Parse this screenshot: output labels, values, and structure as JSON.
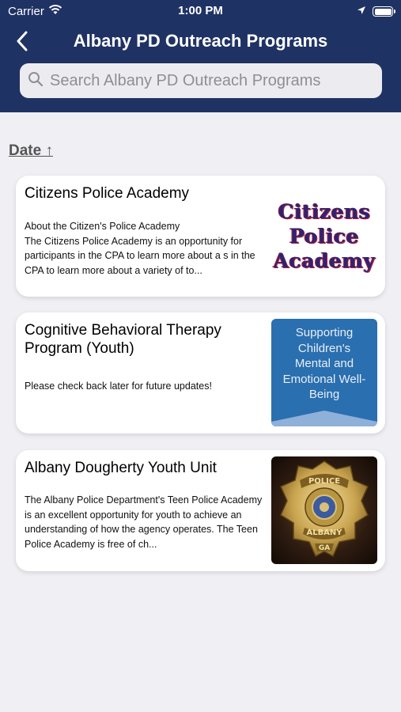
{
  "status_bar": {
    "carrier": "Carrier",
    "time": "1:00 PM"
  },
  "nav": {
    "title": "Albany PD Outreach Programs"
  },
  "search": {
    "placeholder": "Search Albany PD Outreach Programs",
    "value": ""
  },
  "sort": {
    "label": "Date ↑"
  },
  "programs": [
    {
      "title": "Citizens Police Academy",
      "description": "About the Citizen's Police Academy\nThe Citizens Police Academy is an opportunity for participants in the CPA to learn more about a s in the CPA to learn more about a variety of to...",
      "image_text": [
        "Citizens",
        "Police",
        "Academy"
      ]
    },
    {
      "title": "Cognitive Behavioral Therapy Program (Youth)",
      "description": "Please check back later for future updates!",
      "image_text": "Supporting Children's Mental and Emotional Well-Being"
    },
    {
      "title": "Albany Dougherty Youth Unit",
      "description": "The Albany Police Department's Teen Police Academy is an excellent opportunity for youth to achieve an understanding of how the agency operates. The Teen Police Academy is free of ch...",
      "image_text": [
        "POLICE",
        "ALBANY",
        "GA"
      ]
    }
  ],
  "colors": {
    "header": "#1f3264",
    "background": "#efeff4",
    "cbt_image": "#2a6faf"
  },
  "icons": [
    "wifi-icon",
    "location-arrow-icon",
    "battery-icon",
    "back-chevron-icon",
    "search-icon"
  ]
}
